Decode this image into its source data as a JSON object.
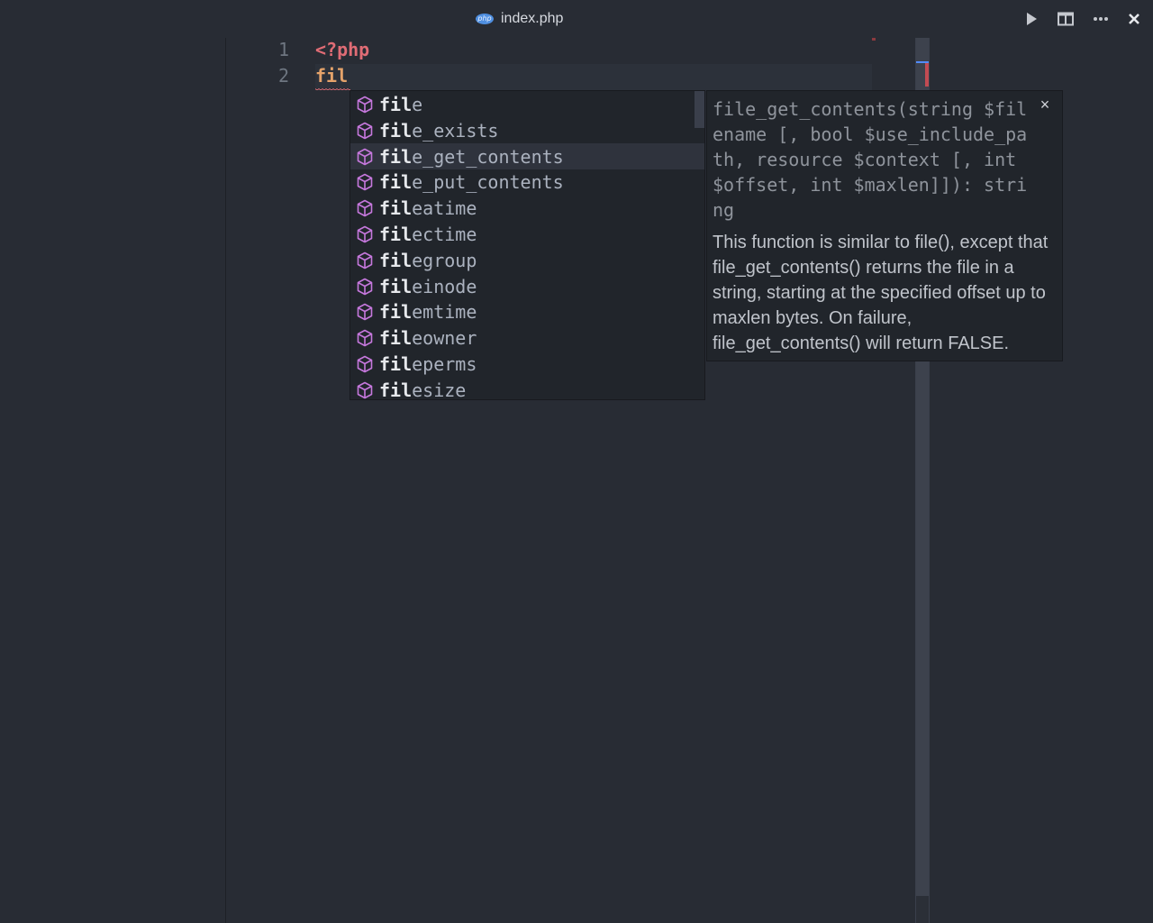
{
  "titlebar": {
    "file_tab": "index.php",
    "file_icon_label": "php",
    "actions": [
      {
        "name": "run",
        "icon": "play-icon"
      },
      {
        "name": "split-editor",
        "icon": "split-icon"
      },
      {
        "name": "more-actions",
        "icon": "ellipsis-icon"
      },
      {
        "name": "close",
        "icon": "close-icon"
      }
    ]
  },
  "editor": {
    "lines": [
      {
        "number": "1",
        "text": "<?php",
        "color": "#e06c75"
      },
      {
        "number": "2",
        "text": "fil",
        "color": "#e5a36a"
      }
    ]
  },
  "suggest": {
    "typed_prefix": "fil",
    "selected_index": 2,
    "kind_icon": "method-cube-icon",
    "kind_icon_color": "#c678dd",
    "items": [
      {
        "prefix": "fil",
        "rest": "e"
      },
      {
        "prefix": "fil",
        "rest": "e_exists"
      },
      {
        "prefix": "fil",
        "rest": "e_get_contents"
      },
      {
        "prefix": "fil",
        "rest": "e_put_contents"
      },
      {
        "prefix": "fil",
        "rest": "eatime"
      },
      {
        "prefix": "fil",
        "rest": "ectime"
      },
      {
        "prefix": "fil",
        "rest": "egroup"
      },
      {
        "prefix": "fil",
        "rest": "einode"
      },
      {
        "prefix": "fil",
        "rest": "emtime"
      },
      {
        "prefix": "fil",
        "rest": "eowner"
      },
      {
        "prefix": "fil",
        "rest": "eperms"
      },
      {
        "prefix": "fil",
        "rest": "esize"
      }
    ]
  },
  "details": {
    "signature": "file_get_contents(string $filename [, bool $use_include_path, resource $context [, int $offset, int $maxlen]]): string",
    "description": "This function is similar to file(), except that file_get_contents() returns the file in a string, starting at the specified offset up to maxlen bytes. On failure, file_get_contents() will return FALSE.",
    "close_label": "×"
  },
  "colors": {
    "background": "#282c34",
    "widget_background": "#21252b",
    "selected_row": "#2f333d",
    "error_marker": "#c24b53"
  }
}
